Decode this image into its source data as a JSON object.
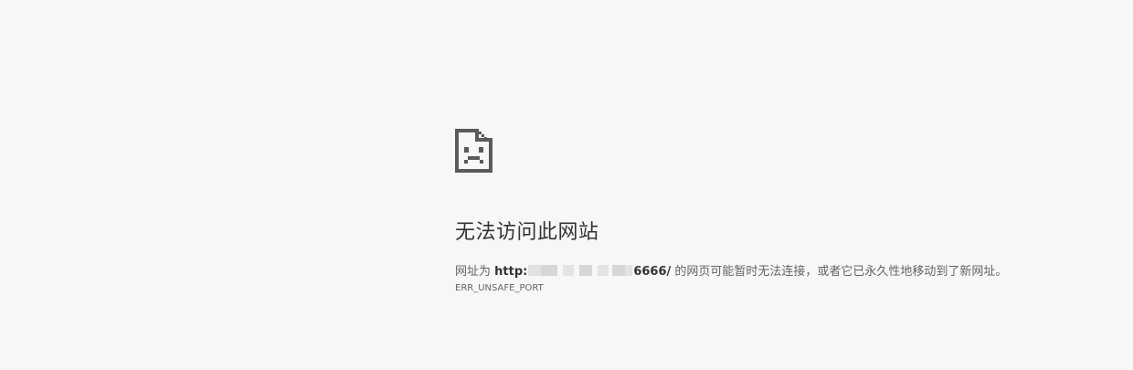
{
  "error_page": {
    "icon": "sad-page-icon",
    "title": "无法访问此网站",
    "description": {
      "prefix": "网址为 ",
      "url_start": "http:",
      "url_end": "6666/",
      "suffix": " 的网页可能暂时无法连接，或者它已永久性地移动到了新网址。"
    },
    "error_code": "ERR_UNSAFE_PORT"
  },
  "colors": {
    "background": "#f7f7f7",
    "icon": "#5a5a5a",
    "title": "#333333",
    "text": "#646464"
  }
}
